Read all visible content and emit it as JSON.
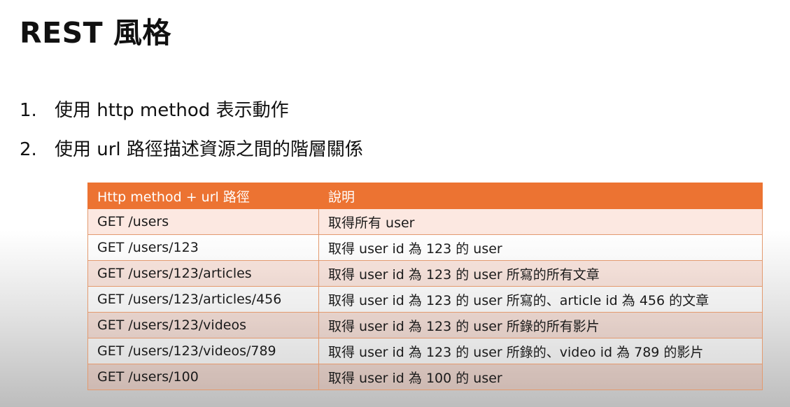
{
  "title": "REST 風格",
  "points": [
    {
      "num": "1.",
      "text": "使用 http method 表示動作"
    },
    {
      "num": "2.",
      "text": "使用 url 路徑描述資源之間的階層關係"
    }
  ],
  "table": {
    "headers": [
      "Http method + url 路徑",
      "說明"
    ],
    "rows": [
      [
        "GET /users",
        "取得所有 user"
      ],
      [
        "GET /users/123",
        "取得 user id 為 123 的 user"
      ],
      [
        "GET /users/123/articles",
        "取得 user id 為 123 的 user 所寫的所有文章"
      ],
      [
        "GET /users/123/articles/456",
        "取得 user id 為 123 的 user 所寫的、article id 為 456 的文章"
      ],
      [
        "GET /users/123/videos",
        "取得 user id 為 123 的 user 所錄的所有影片"
      ],
      [
        "GET /users/123/videos/789",
        "取得 user id 為 123 的 user 所錄的、video id 為 789 的影片"
      ],
      [
        "GET /users/100",
        "取得 user id 為 100 的 user"
      ]
    ]
  },
  "colors": {
    "header_bg": "#ec7332",
    "header_text": "#ffffff",
    "row_tint": "#f6d9cd",
    "border": "#e39a6f"
  }
}
